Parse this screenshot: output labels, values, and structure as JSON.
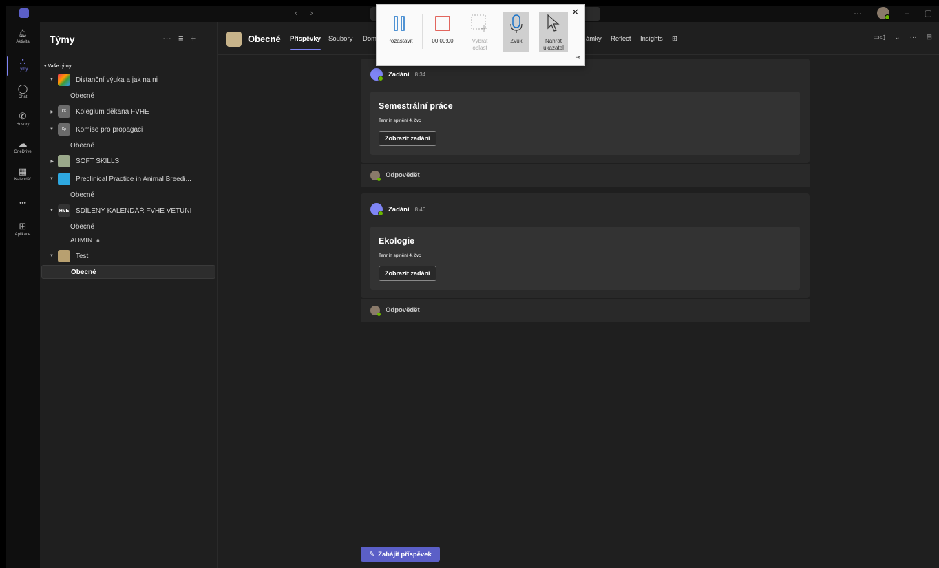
{
  "topbar": {
    "nav_back": "‹",
    "nav_fwd": "›",
    "more": "···",
    "minimize": "–",
    "restore": "▢"
  },
  "rail": [
    {
      "label": "Aktivita",
      "icon": "bell-icon",
      "glyph": "🔔"
    },
    {
      "label": "Týmy",
      "icon": "teams-icon",
      "glyph": "⛬"
    },
    {
      "label": "Chat",
      "icon": "chat-icon",
      "glyph": "◯"
    },
    {
      "label": "Hovory",
      "icon": "phone-icon",
      "glyph": "✆"
    },
    {
      "label": "OneDrive",
      "icon": "cloud-icon",
      "glyph": "☁"
    },
    {
      "label": "Kalendář",
      "icon": "calendar-icon",
      "glyph": "▦"
    },
    {
      "label": "",
      "icon": "more-icon",
      "glyph": "•••"
    },
    {
      "label": "Aplikace",
      "icon": "plus-square-icon",
      "glyph": "⊞"
    }
  ],
  "sidebar": {
    "title": "Týmy",
    "more": "···",
    "filter": "≡",
    "add": "+",
    "group_header": "Vaše týmy",
    "rows": [
      {
        "type": "team",
        "name": "Distanční výuka a jak na ni",
        "expanded": true,
        "icon_color": "#3b9c3b",
        "initials": ""
      },
      {
        "type": "channel",
        "name": "Obecné"
      },
      {
        "type": "team",
        "name": "Kolegium děkana FVHE",
        "expanded": false,
        "icon_color": "#6b6b6b",
        "initials": "KF"
      },
      {
        "type": "team",
        "name": "Komise pro propagaci",
        "expanded": true,
        "icon_color": "#6b6b6b",
        "initials": "Kp"
      },
      {
        "type": "channel",
        "name": "Obecné"
      },
      {
        "type": "team",
        "name": "SOFT SKILLS",
        "expanded": false,
        "icon_color": "#9aa88a",
        "initials": ""
      },
      {
        "type": "team",
        "name": "Preclinical Practice in Animal Breedi...",
        "expanded": true,
        "icon_color": "#2ea8e0",
        "initials": ""
      },
      {
        "type": "channel",
        "name": "Obecné"
      },
      {
        "type": "team",
        "name": "SDÍLENÝ KALENDÁŘ FVHE VETUNI",
        "expanded": true,
        "icon_color": "#333333",
        "initials": "HVE"
      },
      {
        "type": "channel",
        "name": "Obecné"
      },
      {
        "type": "channel",
        "name": "ADMIN",
        "locked": true
      },
      {
        "type": "team",
        "name": "Test",
        "expanded": true,
        "icon_color": "#b8a070",
        "initials": ""
      },
      {
        "type": "channel",
        "name": "Obecné",
        "selected": true
      }
    ]
  },
  "channel": {
    "name": "Obecné",
    "tabs": [
      {
        "label": "Příspěvky",
        "active": true
      },
      {
        "label": "Soubory"
      },
      {
        "label": "Dom"
      },
      {
        "label": "ámky"
      },
      {
        "label": "Reflect"
      },
      {
        "label": "Insights"
      },
      {
        "label": "⊞"
      }
    ],
    "header_right": {
      "video": "▭◁",
      "chevron": "⌄",
      "more": "···",
      "panel": "⊟"
    }
  },
  "posts": [
    {
      "author": "Zadání",
      "time": "8:34",
      "card_title": "Semestrální práce",
      "due": "Termín splnění 4. čvc",
      "button": "Zobrazit zadání",
      "reply": "Odpovědět"
    },
    {
      "author": "Zadání",
      "time": "8:46",
      "card_title": "Ekologie",
      "due": "Termín splnění 4. čvc",
      "button": "Zobrazit zadání",
      "reply": "Odpovědět"
    }
  ],
  "start_post": {
    "label": "Zahájit příspěvek",
    "icon": "✎"
  },
  "recorder": {
    "close": "✕",
    "pin": "⊸",
    "pause": "Pozastavit",
    "timer": "00:00:00",
    "select_area_1": "Vybrat",
    "select_area_2": "oblast",
    "audio": "Zvuk",
    "record_pointer_1": "Nahrát",
    "record_pointer_2": "ukazatel"
  }
}
